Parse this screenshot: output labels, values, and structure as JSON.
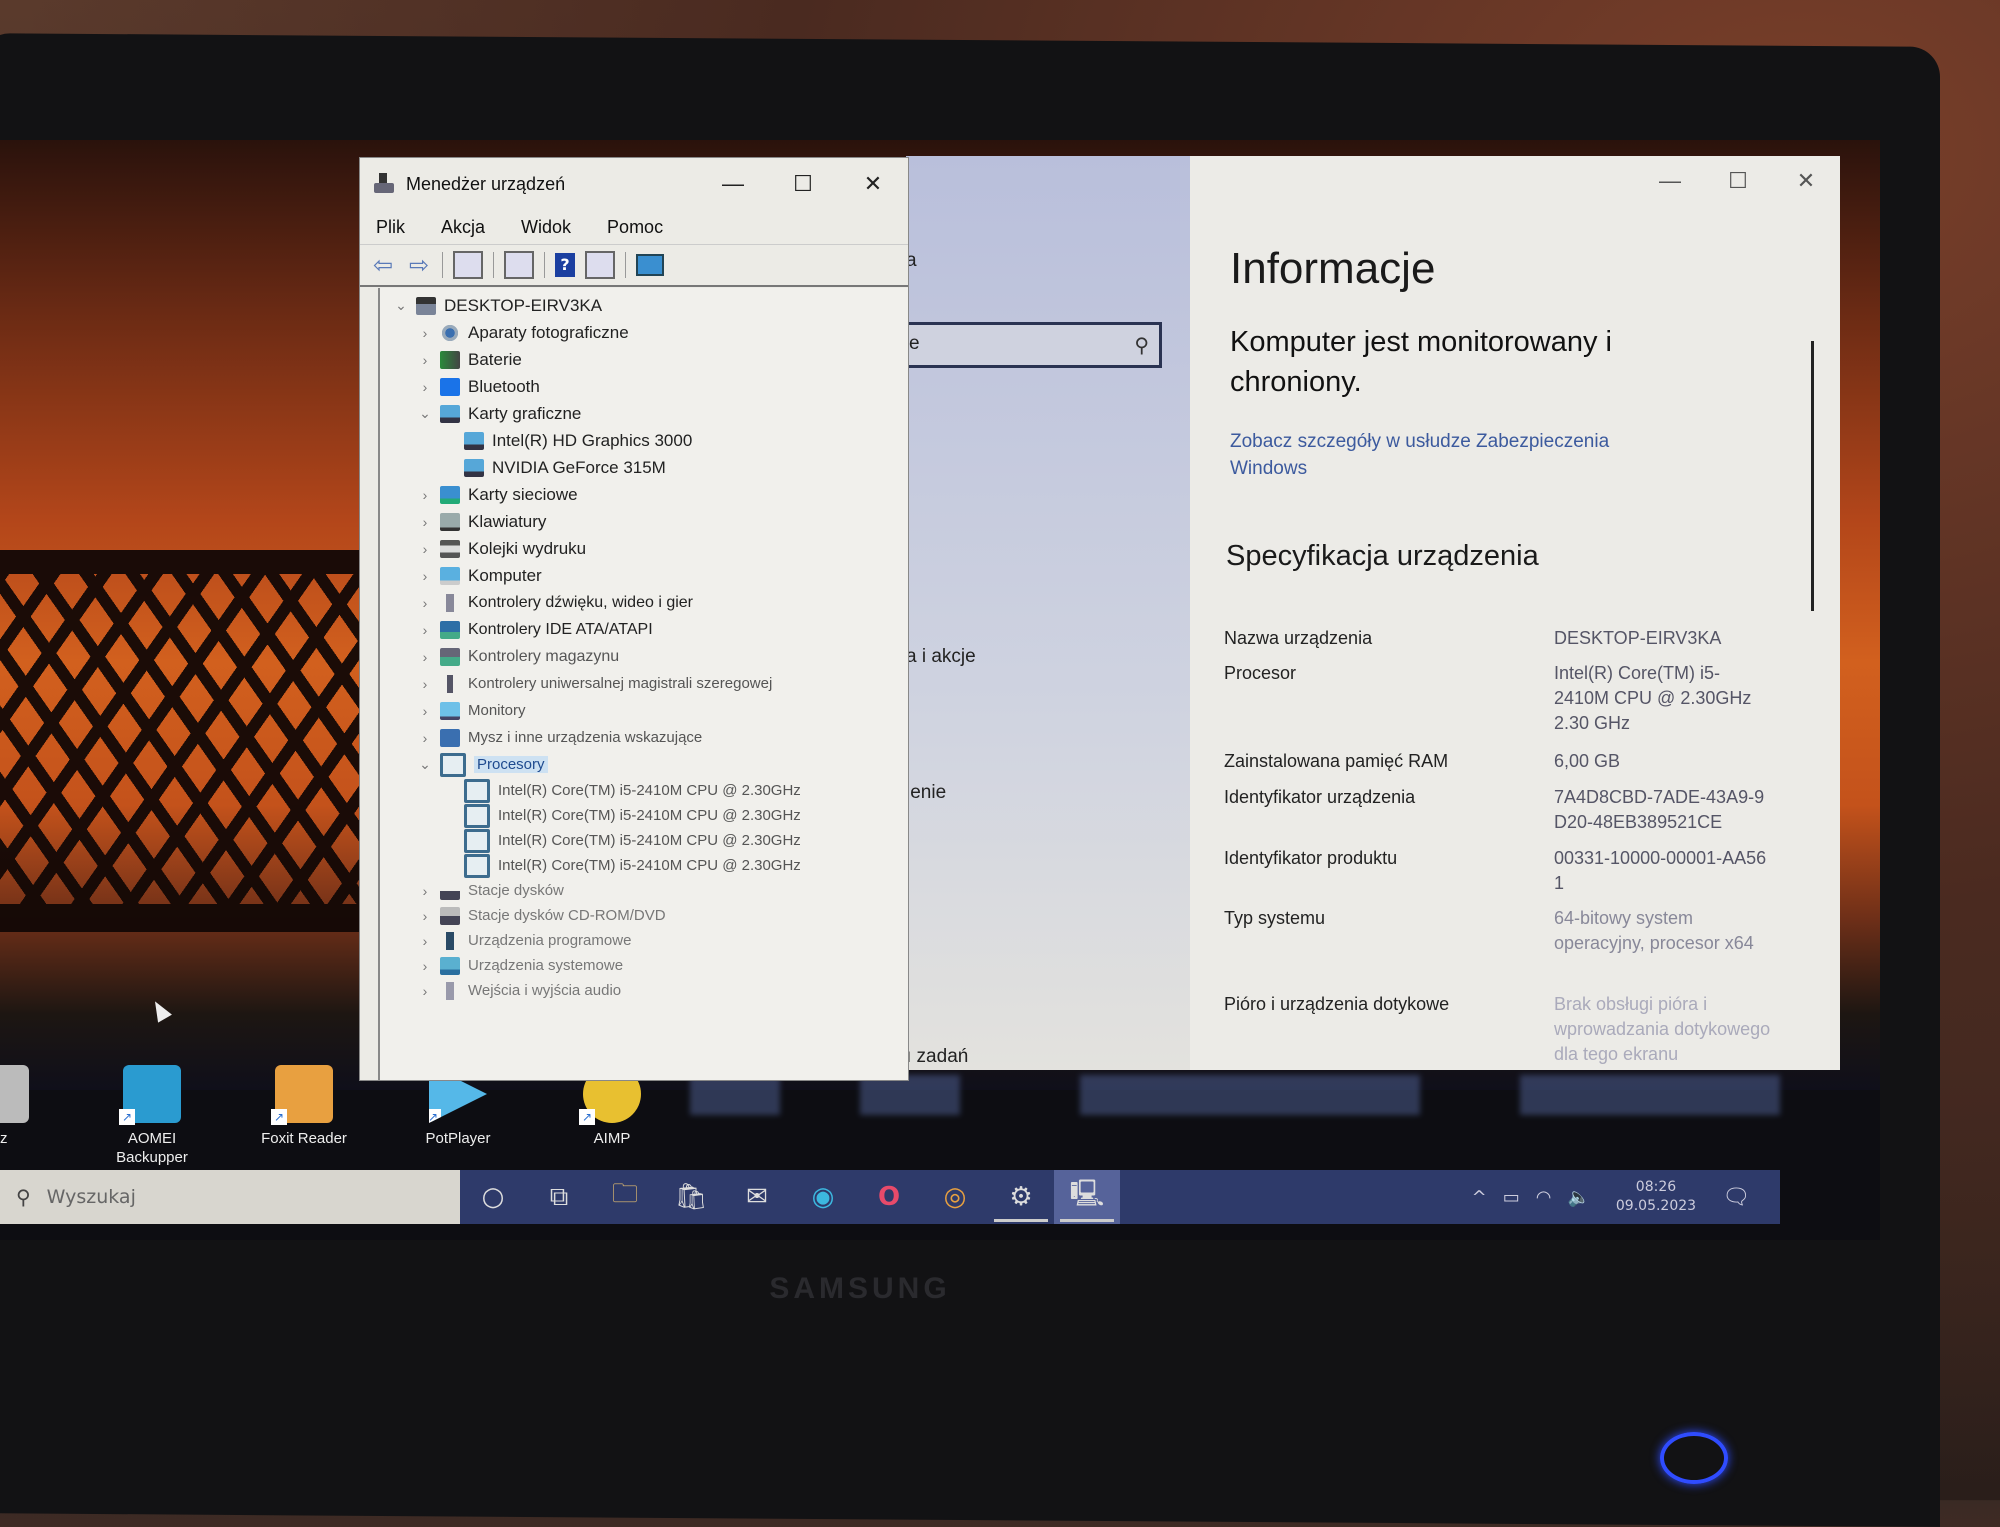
{
  "device_manager": {
    "title": "Menedżer urządzeń",
    "window_controls": {
      "minimize": "—",
      "maximize": "☐",
      "close": "✕"
    },
    "menu": [
      "Plik",
      "Akcja",
      "Widok",
      "Pomoc"
    ],
    "toolbar": [
      {
        "name": "back",
        "glyph": "⇦"
      },
      {
        "name": "forward",
        "glyph": "⇨"
      },
      {
        "name": "show-hide-console-tree"
      },
      {
        "name": "properties"
      },
      {
        "name": "help",
        "glyph": "?"
      },
      {
        "name": "show-action-pane"
      },
      {
        "name": "scan-hardware"
      }
    ],
    "tree": {
      "root": {
        "label": "DESKTOP-EIRV3KA",
        "expanded": true
      },
      "categories": [
        {
          "label": "Aparaty fotograficzne",
          "icon": "camera",
          "expanded": false
        },
        {
          "label": "Baterie",
          "icon": "battery",
          "expanded": false
        },
        {
          "label": "Bluetooth",
          "icon": "bluetooth",
          "expanded": false
        },
        {
          "label": "Karty graficzne",
          "icon": "display-adapter",
          "expanded": true,
          "children": [
            "Intel(R) HD Graphics 3000",
            "NVIDIA GeForce 315M"
          ]
        },
        {
          "label": "Karty sieciowe",
          "icon": "network",
          "expanded": false
        },
        {
          "label": "Klawiatury",
          "icon": "keyboard",
          "expanded": false
        },
        {
          "label": "Kolejki wydruku",
          "icon": "printer",
          "expanded": false
        },
        {
          "label": "Komputer",
          "icon": "computer",
          "expanded": false
        },
        {
          "label": "Kontrolery dźwięku, wideo i gier",
          "icon": "sound",
          "expanded": false
        },
        {
          "label": "Kontrolery IDE ATA/ATAPI",
          "icon": "ide",
          "expanded": false
        },
        {
          "label": "Kontrolery magazynu",
          "icon": "storage",
          "expanded": false
        },
        {
          "label": "Kontrolery uniwersalnej magistrali szeregowej",
          "icon": "usb",
          "expanded": false
        },
        {
          "label": "Monitory",
          "icon": "monitor",
          "expanded": false
        },
        {
          "label": "Mysz i inne urządzenia wskazujące",
          "icon": "mouse",
          "expanded": false
        },
        {
          "label": "Procesory",
          "icon": "cpu",
          "expanded": true,
          "selected": true,
          "children": [
            "Intel(R) Core(TM) i5-2410M CPU @ 2.30GHz",
            "Intel(R) Core(TM) i5-2410M CPU @ 2.30GHz",
            "Intel(R) Core(TM) i5-2410M CPU @ 2.30GHz",
            "Intel(R) Core(TM) i5-2410M CPU @ 2.30GHz"
          ]
        },
        {
          "label": "Stacje dysków",
          "icon": "disk",
          "expanded": false
        },
        {
          "label": "Stacje dysków CD-ROM/DVD",
          "icon": "cdrom",
          "expanded": false
        },
        {
          "label": "Urządzenia programowe",
          "icon": "software-device",
          "expanded": false
        },
        {
          "label": "Urządzenia systemowe",
          "icon": "system-device",
          "expanded": false
        },
        {
          "label": "Wejścia i wyjścia audio",
          "icon": "audio-io",
          "expanded": false
        }
      ]
    }
  },
  "settings": {
    "window_controls": {
      "minimize": "—",
      "maximize": "☐",
      "close": "✕"
    },
    "nav": {
      "search_fragment": "e",
      "visible_fragments": [
        "a",
        "a i akcje",
        "ienie",
        "ı zadań"
      ]
    },
    "page_title": "Informacje",
    "protection_status": "Komputer jest monitorowany i chroniony.",
    "security_link": "Zobacz szczegóły w usłudze Zabezpieczenia Windows",
    "section_title": "Specyfikacja urządzenia",
    "specs": [
      {
        "key": "Nazwa urządzenia",
        "value": "DESKTOP-EIRV3KA"
      },
      {
        "key": "Procesor",
        "value": "Intel(R) Core(TM) i5-2410M CPU @ 2.30GHz   2.30 GHz"
      },
      {
        "key": "Zainstalowana pamięć RAM",
        "value": "6,00 GB"
      },
      {
        "key": "Identyfikator urządzenia",
        "value": "7A4D8CBD-7ADE-43A9-9D20-48EB389521CE"
      },
      {
        "key": "Identyfikator produktu",
        "value": "00331-10000-00001-AA561"
      },
      {
        "key": "Typ systemu",
        "value": "64-bitowy system operacyjny, procesor x64"
      },
      {
        "key": "Pióro i urządzenia dotykowe",
        "value": "Brak obsługi pióra i wprowadzania dotykowego dla tego ekranu"
      }
    ]
  },
  "desktop": {
    "icons": [
      {
        "label": "sz",
        "color": "#bbbbbb"
      },
      {
        "label": "AOMEI Backupper Standard",
        "color": "#2a9bd0"
      },
      {
        "label": "Foxit Reader",
        "color": "#e8a040"
      },
      {
        "label": "PotPlayer",
        "color": "#55b8e8"
      },
      {
        "label": "AIMP",
        "color": "#e8c030"
      }
    ]
  },
  "taskbar": {
    "search_placeholder": "Wyszukaj",
    "apps": [
      {
        "name": "cortana",
        "glyph": "○"
      },
      {
        "name": "task-view",
        "glyph": "⧉"
      },
      {
        "name": "file-explorer",
        "glyph": "🗀"
      },
      {
        "name": "microsoft-store",
        "glyph": "🛍"
      },
      {
        "name": "mail",
        "glyph": "✉"
      },
      {
        "name": "edge",
        "glyph": "◉"
      },
      {
        "name": "opera",
        "glyph": "O"
      },
      {
        "name": "chrome",
        "glyph": "◎"
      },
      {
        "name": "settings",
        "glyph": "⚙",
        "active": true
      },
      {
        "name": "device-manager",
        "glyph": "🖳",
        "focused": true
      }
    ],
    "tray": {
      "chevron": "^",
      "battery": "▭",
      "wifi": "◠",
      "volume": "🔈"
    },
    "time": "08:26",
    "date": "09.05.2023",
    "notification_glyph": "🗨"
  },
  "hardware": {
    "brand": "SAMSUNG"
  },
  "colors": {
    "accent_link": "#3c5a9e",
    "selection": "#cde1f2",
    "taskbar": "#2e3a6a",
    "power_led": "#2f4cff"
  }
}
